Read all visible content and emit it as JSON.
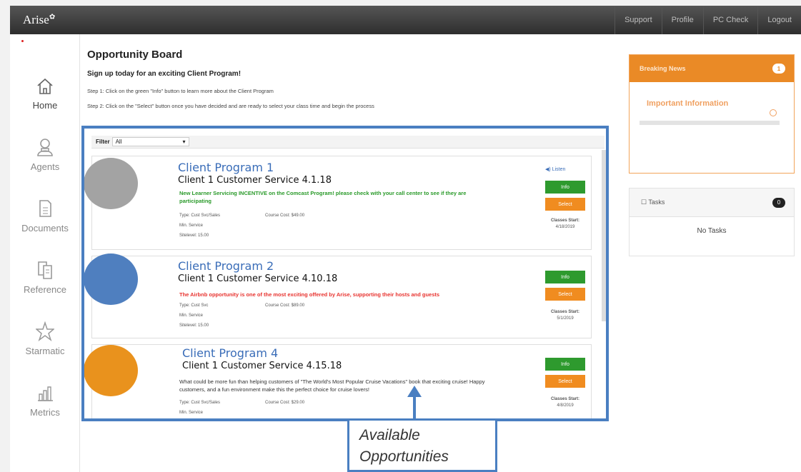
{
  "app": {
    "logo": "Arise",
    "logo_mark": "✿"
  },
  "topnav": [
    "Support",
    "Profile",
    "PC Check",
    "Logout"
  ],
  "sidebar": {
    "items": [
      {
        "label": "Home",
        "icon": "home-icon",
        "active": true
      },
      {
        "label": "Agents",
        "icon": "agent-icon",
        "active": false
      },
      {
        "label": "Documents",
        "icon": "document-icon",
        "active": false
      },
      {
        "label": "Reference",
        "icon": "reference-icon",
        "active": false
      },
      {
        "label": "Starmatic",
        "icon": "star-icon",
        "active": false
      },
      {
        "label": "Metrics",
        "icon": "chart-icon",
        "active": false
      }
    ]
  },
  "main": {
    "title": "Opportunity Board",
    "subtitle": "Sign up today for an exciting Client Program!",
    "step1": "Step 1: Click on the green \"Info\" button to learn more about the Client Program",
    "step2": "Step 2: Click on the \"Select\" button once you have decided and are ready to select your class time and begin the process"
  },
  "filter": {
    "label": "Filter",
    "value": "All"
  },
  "cards": [
    {
      "program": "Client Program 1",
      "service": "Client 1 Customer Service 4.1.18",
      "description": "New Learner Servicing INCENTIVE on the Comcast Program! please check with your call center to see if they are participating",
      "desc_color": "#2a9a2a",
      "type": "Type: Cust Svc/Sales",
      "course_cost": "Course Cost: $49.00",
      "min_service": "Min. Service",
      "sitelevel": "Sitelevel: 15.00",
      "listen": "Listen",
      "info_label": "Info",
      "select_label": "Select",
      "classes_label": "Classes Start:",
      "classes_date": "4/18/2019",
      "circle_color": "#a3a3a3"
    },
    {
      "program": "Client Program 2",
      "service": "Client 1 Customer Service 4.10.18",
      "description": "The Airbnb opportunity is one of the most exciting offered by Arise, supporting their hosts and guests",
      "desc_color": "#e8332f",
      "type": "Type: Cust Svc",
      "course_cost": "Course Cost: $89.00",
      "min_service": "Min. Service",
      "sitelevel": "Sitelevel: 15.00",
      "info_label": "Info",
      "select_label": "Select",
      "classes_label": "Classes Start:",
      "classes_date": "5/1/2019",
      "circle_color": "#4f7fbf"
    },
    {
      "program": "Client Program 4",
      "service": "Client 1 Customer Service 4.15.18",
      "description": "What could be more fun than helping customers of \"The World's Most Popular Cruise Vacations\" book that exciting cruise! Happy customers, and a fun environment make this the perfect choice for cruise lovers!",
      "desc_color": "#333333",
      "type": "Type: Cust Svc/Sales",
      "course_cost": "Course Cost: $29.00",
      "min_service": "Min. Service",
      "info_label": "Info",
      "select_label": "Select",
      "classes_label": "Classes Start:",
      "classes_date": "4/8/2019",
      "circle_color": "#e9921d"
    }
  ],
  "news": {
    "title": "Breaking News",
    "count": "1",
    "link": "Important Information"
  },
  "tasks": {
    "title": "Tasks",
    "count": "0",
    "empty": "No Tasks"
  },
  "callout": {
    "line1": "Available",
    "line2": "Opportunities"
  },
  "colors": {
    "accent_blue": "#4a7fc1",
    "orange": "#ea8a26",
    "green": "#2e9a2e"
  }
}
